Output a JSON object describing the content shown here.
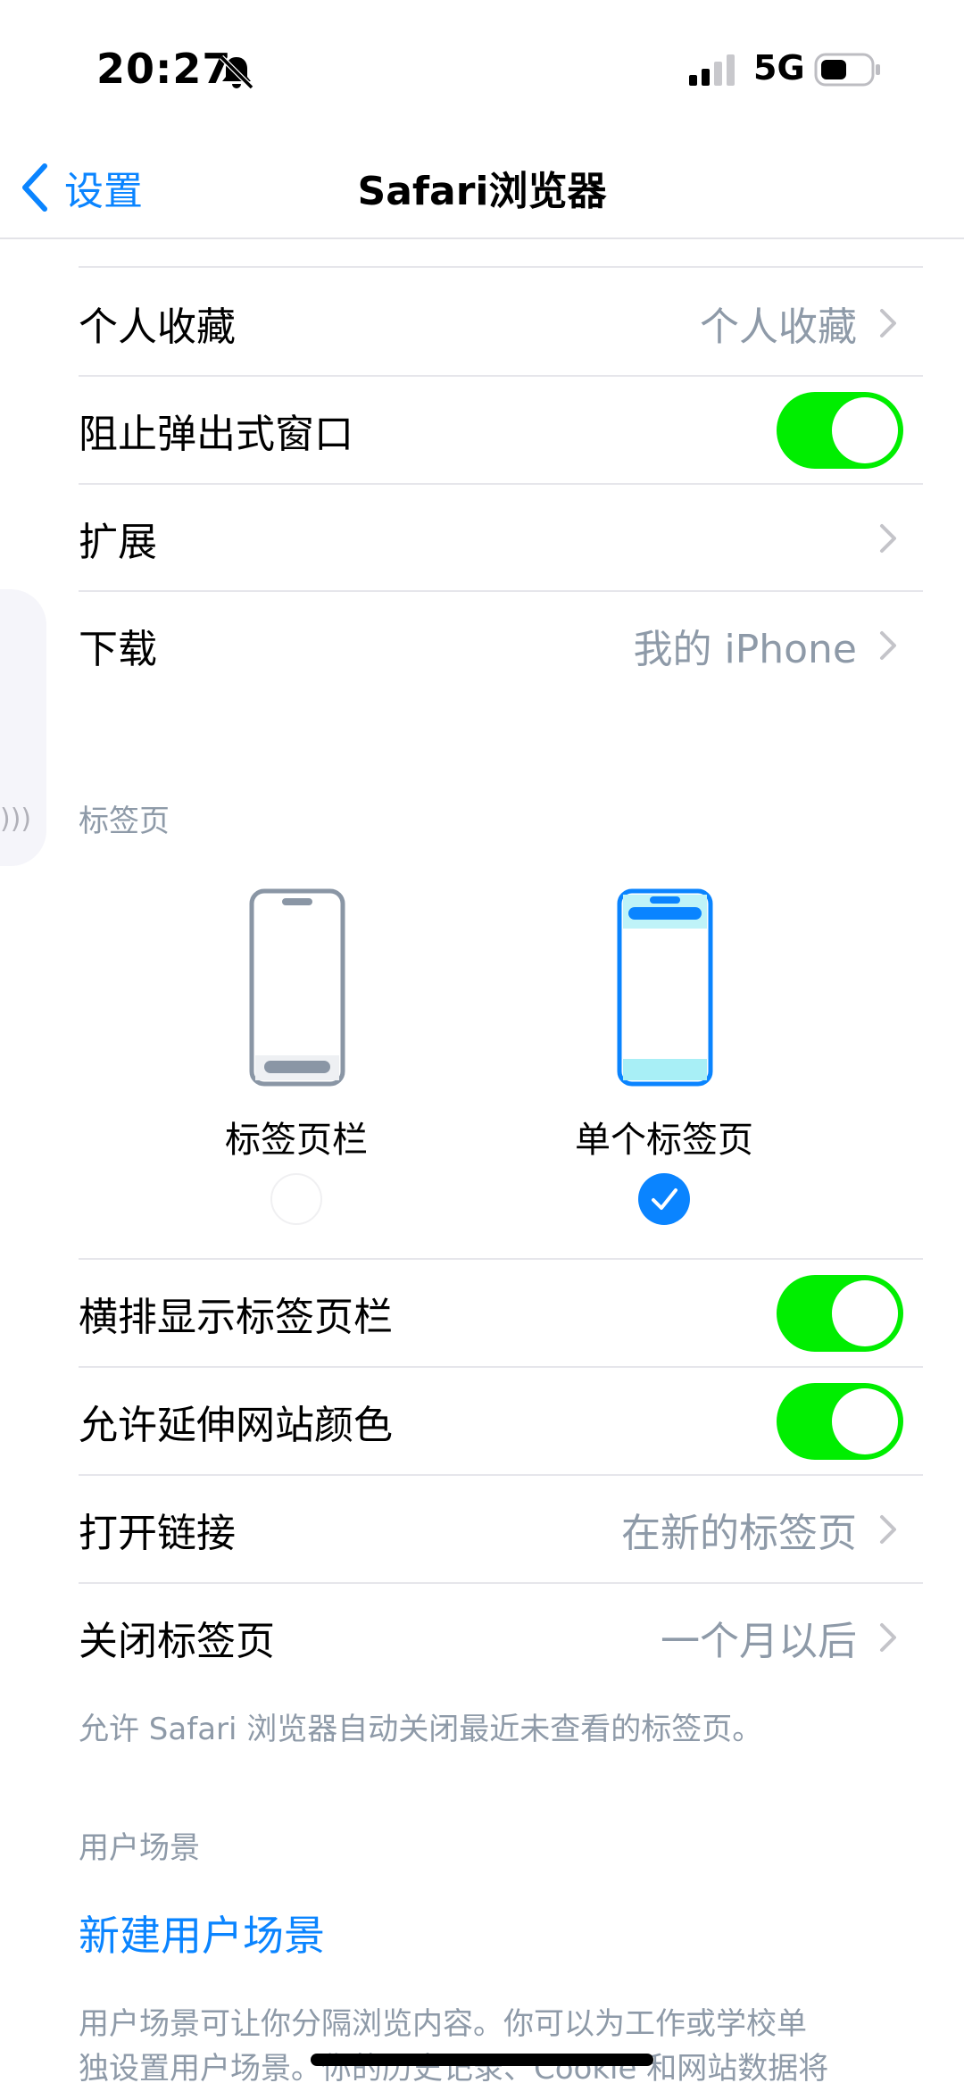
{
  "status_bar": {
    "time": "20:27",
    "network": "5G"
  },
  "nav": {
    "back_label": "设置",
    "title": "Safari浏览器"
  },
  "rows_top": [
    {
      "label": "个人收藏",
      "value": "个人收藏",
      "type": "link"
    },
    {
      "label": "阻止弹出式窗口",
      "type": "toggle",
      "on": true
    },
    {
      "label": "扩展",
      "value": "",
      "type": "link"
    },
    {
      "label": "下载",
      "value": "我的 iPhone",
      "type": "link"
    }
  ],
  "tabs_section": {
    "header": "标签页",
    "options": [
      {
        "label": "标签页栏",
        "selected": false
      },
      {
        "label": "单个标签页",
        "selected": true
      }
    ],
    "rows": [
      {
        "label": "横排显示标签页栏",
        "type": "toggle",
        "on": true
      },
      {
        "label": "允许延伸网站颜色",
        "type": "toggle",
        "on": true
      },
      {
        "label": "打开链接",
        "value": "在新的标签页",
        "type": "link"
      },
      {
        "label": "关闭标签页",
        "value": "一个月以后",
        "type": "link"
      }
    ],
    "footnote": "允许 Safari 浏览器自动关闭最近未查看的标签页。"
  },
  "profiles_section": {
    "header": "用户场景",
    "new_profile": "新建用户场景",
    "footnote_line1": "用户场景可让你分隔浏览内容。你可以为工作或学校单",
    "footnote_line2": "独设置用户场景。你的历史记录、Cookie 和网站数据将"
  },
  "colors": {
    "accent": "#0a84ff",
    "toggle_on": "#00ee00",
    "secondary_text": "#8e9aa8"
  }
}
